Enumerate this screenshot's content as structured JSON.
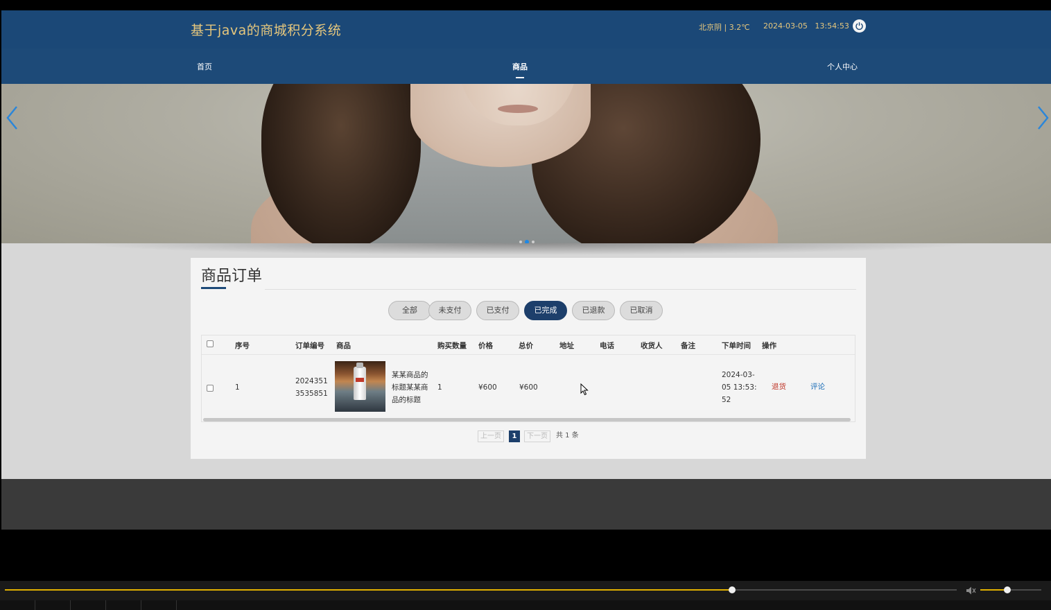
{
  "header": {
    "site_title": "基于java的商城积分系统",
    "weather": "北京阴 | 3.2℃",
    "datetime": "2024-03-05   13:54:53"
  },
  "nav": {
    "items": [
      {
        "label": "首页"
      },
      {
        "label": "商品"
      },
      {
        "label": "个人中心"
      }
    ],
    "active": "商品"
  },
  "banner": {
    "slide_count": 3,
    "active_slide": 2
  },
  "orders": {
    "title": "商品订单",
    "status_tabs": [
      "全部",
      "未支付",
      "已支付",
      "已完成",
      "已退款",
      "已取消"
    ],
    "active_tab": "已完成",
    "columns": [
      "序号",
      "订单编号",
      "商品",
      "购买数量",
      "价格",
      "总价",
      "地址",
      "电话",
      "收货人",
      "备注",
      "下单时间",
      "操作"
    ],
    "rows": [
      {
        "index": "1",
        "order_no_line1": "2024351",
        "order_no_line2": "3535851",
        "product_name_line1": "某某商品的",
        "product_name_line2": "标题某某商",
        "product_name_line3": "品的标题",
        "quantity": "1",
        "price": "¥600",
        "total": "¥600",
        "address": "",
        "phone": "",
        "receiver": "",
        "remark": "",
        "time_line1": "2024-03-",
        "time_line2": "05 13:53:",
        "time_line3": "52",
        "action_refund": "退货",
        "action_comment": "评论"
      }
    ]
  },
  "pagination": {
    "prev": "上一页",
    "current": "1",
    "next": "下一页",
    "total": "共 1 条"
  },
  "player": {
    "seek_progress": 0.764,
    "volume_level": 0.44
  },
  "colors": {
    "header_bg": "#1b4877",
    "title_gold": "#e6c77d",
    "active_tab": "#1d3f6b",
    "refund_red": "#c0392b",
    "comment_blue": "#1e6fb8",
    "player_accent": "#e0b000"
  }
}
